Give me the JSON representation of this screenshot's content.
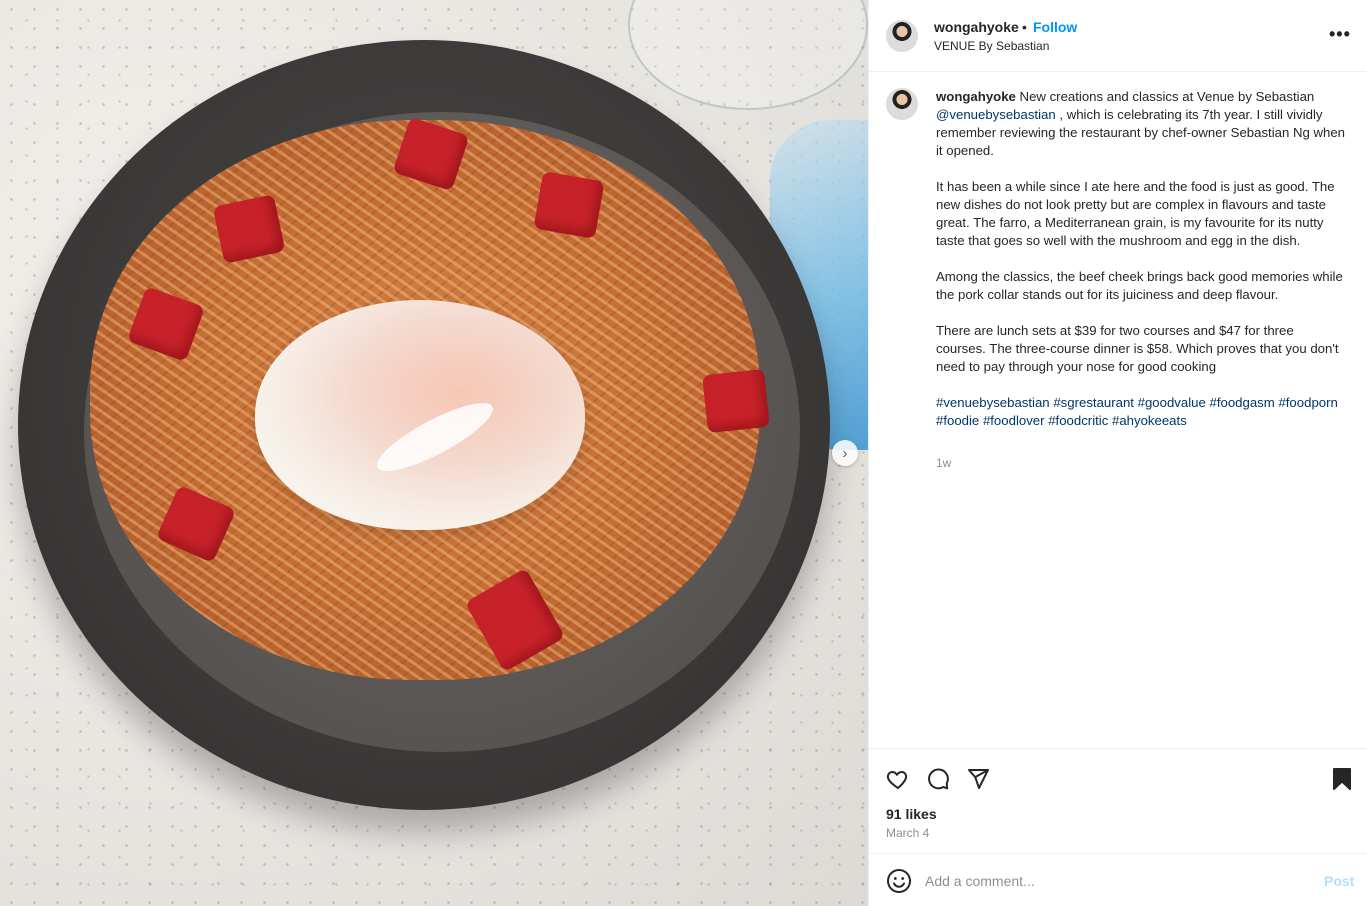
{
  "post": {
    "username": "wongahyoke",
    "dot": "•",
    "follow_label": "Follow",
    "location": "VENUE By Sebastian",
    "more_label": "•••",
    "next_label": "›"
  },
  "caption": {
    "username": "wongahyoke",
    "intro": "New creations and classics at Venue by Sebastian",
    "mention": "@venuebysebastian",
    "intro_rest": ", which is celebrating its 7th year. I still vividly remember reviewing the restaurant by chef-owner Sebastian Ng when it opened.",
    "para2": "It has been a while since I ate here and the food is just as good. The new dishes do not look pretty but are complex in flavours and taste great. The farro, a Mediterranean grain, is my favourite for its nutty taste that goes so well with the mushroom and egg in the dish.",
    "para3": "Among the classics, the beef cheek brings back good memories while the pork collar stands out for its juiciness and deep flavour.",
    "para4": "There are lunch sets at $39 for two courses and $47 for three courses. The three-course dinner is $58. Which proves that you don't need to pay through your nose for good cooking",
    "hashtags": [
      "#venuebysebastian",
      "#sgrestaurant",
      "#goodvalue",
      "#foodgasm",
      "#foodporn",
      "#foodie",
      "#foodlover",
      "#foodcritic",
      "#ahyokeeats"
    ],
    "age": "1w"
  },
  "actions": {
    "icons": [
      "heart-icon",
      "comment-icon",
      "share-icon",
      "bookmark-icon"
    ],
    "likes": "91 likes",
    "date": "March 4"
  },
  "comment": {
    "placeholder": "Add a comment...",
    "post_label": "Post"
  },
  "colors": {
    "link": "#0095f6",
    "hashtag": "#00376b",
    "muted": "#8e8e8e",
    "post_disabled": "#b2dffc"
  }
}
